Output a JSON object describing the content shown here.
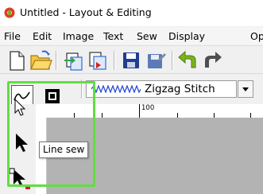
{
  "window": {
    "title": "Untitled - Layout & Editing"
  },
  "menu": {
    "items": [
      "File",
      "Edit",
      "Image",
      "Text",
      "Sew",
      "Display",
      "Op"
    ]
  },
  "stitch_selector": {
    "value": "Zigzag Stitch"
  },
  "ruler": {
    "label": "100"
  },
  "tooltip": {
    "text": "Line sew"
  },
  "colors": {
    "highlight": "#62dd43",
    "canvas": "#b3b3b3",
    "accent_red": "#d42020",
    "save_blue": "#1f3e91"
  },
  "icons": {
    "toolbar": [
      "new-document-icon",
      "open-folder-icon",
      "import-icon",
      "export-icon",
      "save-icon",
      "save-as-icon",
      "undo-icon",
      "redo-icon"
    ],
    "sew": [
      "line-sew-icon",
      "region-sew-icon",
      "zigzag-stitch-icon"
    ],
    "tools": [
      "select-arrow-icon",
      "point-edit-icon"
    ]
  }
}
